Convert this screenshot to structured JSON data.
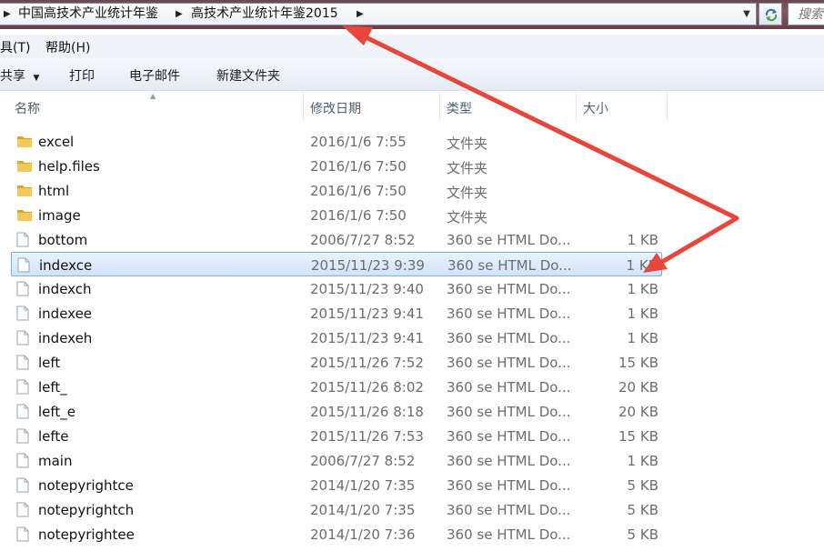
{
  "address_bar": {
    "crumbs": [
      "中国高技术产业统计年鉴",
      "高技术产业统计年鉴2015"
    ],
    "dropdown_icon": "chevron-down-icon",
    "refresh_icon": "refresh-icon"
  },
  "search": {
    "placeholder": "搜索"
  },
  "menu": {
    "items": [
      "具(T)",
      "帮助(H)"
    ]
  },
  "toolbar": {
    "share": "共享",
    "print": "打印",
    "email": "电子邮件",
    "new_folder": "新建文件夹"
  },
  "columns": {
    "name": "名称",
    "date": "修改日期",
    "type": "类型",
    "size": "大小"
  },
  "files": [
    {
      "name": "excel",
      "date": "2016/1/6 7:55",
      "type": "文件夹",
      "size": "",
      "kind": "folder"
    },
    {
      "name": "help.files",
      "date": "2016/1/6 7:50",
      "type": "文件夹",
      "size": "",
      "kind": "folder"
    },
    {
      "name": "html",
      "date": "2016/1/6 7:50",
      "type": "文件夹",
      "size": "",
      "kind": "folder"
    },
    {
      "name": "image",
      "date": "2016/1/6 7:50",
      "type": "文件夹",
      "size": "",
      "kind": "folder"
    },
    {
      "name": "bottom",
      "date": "2006/7/27 8:52",
      "type": "360 se HTML Do...",
      "size": "1 KB",
      "kind": "file"
    },
    {
      "name": "indexce",
      "date": "2015/11/23 9:39",
      "type": "360 se HTML Do...",
      "size": "1 KB",
      "kind": "file",
      "selected": true
    },
    {
      "name": "indexch",
      "date": "2015/11/23 9:40",
      "type": "360 se HTML Do...",
      "size": "1 KB",
      "kind": "file"
    },
    {
      "name": "indexee",
      "date": "2015/11/23 9:41",
      "type": "360 se HTML Do...",
      "size": "1 KB",
      "kind": "file"
    },
    {
      "name": "indexeh",
      "date": "2015/11/23 9:41",
      "type": "360 se HTML Do...",
      "size": "1 KB",
      "kind": "file"
    },
    {
      "name": "left",
      "date": "2015/11/26 7:52",
      "type": "360 se HTML Do...",
      "size": "15 KB",
      "kind": "file"
    },
    {
      "name": "left_",
      "date": "2015/11/26 8:02",
      "type": "360 se HTML Do...",
      "size": "20 KB",
      "kind": "file"
    },
    {
      "name": "left_e",
      "date": "2015/11/26 8:18",
      "type": "360 se HTML Do...",
      "size": "20 KB",
      "kind": "file"
    },
    {
      "name": "lefte",
      "date": "2015/11/26 7:53",
      "type": "360 se HTML Do...",
      "size": "15 KB",
      "kind": "file"
    },
    {
      "name": "main",
      "date": "2006/7/27 8:52",
      "type": "360 se HTML Do...",
      "size": "1 KB",
      "kind": "file"
    },
    {
      "name": "notepyrightce",
      "date": "2014/1/20 7:35",
      "type": "360 se HTML Do...",
      "size": "5 KB",
      "kind": "file"
    },
    {
      "name": "notepyrightch",
      "date": "2014/1/20 7:35",
      "type": "360 se HTML Do...",
      "size": "5 KB",
      "kind": "file"
    },
    {
      "name": "notepyrightee",
      "date": "2014/1/20 7:36",
      "type": "360 se HTML Do...",
      "size": "5 KB",
      "kind": "file"
    }
  ],
  "colors": {
    "annotation_arrow": "#e8463a",
    "folder": "#e8b93c",
    "selection": "#cfe4fb"
  }
}
